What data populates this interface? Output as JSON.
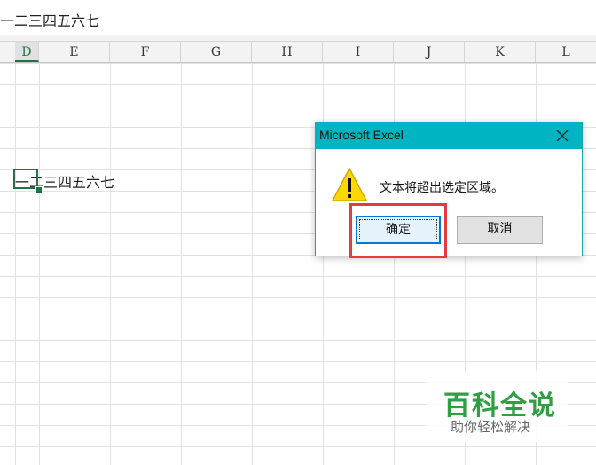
{
  "formula_bar": {
    "content": "一二三四五六七"
  },
  "columns": [
    "D",
    "E",
    "F",
    "G",
    "H",
    "I",
    "J",
    "K",
    "L"
  ],
  "active_column": "D",
  "cell": {
    "content": "一二三四五六七"
  },
  "dialog": {
    "title": "Microsoft Excel",
    "message": "文本将超出选定区域。",
    "ok_label": "确定",
    "cancel_label": "取消"
  },
  "watermark": {
    "main": "百科全说",
    "sub": "助你轻松解决"
  },
  "colors": {
    "accent": "#217346",
    "dialog_title": "#00b4c2",
    "highlight": "#e23c3c",
    "watermark": "#2ea043"
  },
  "icons": {
    "close": "close-icon",
    "warning": "warning-icon"
  }
}
